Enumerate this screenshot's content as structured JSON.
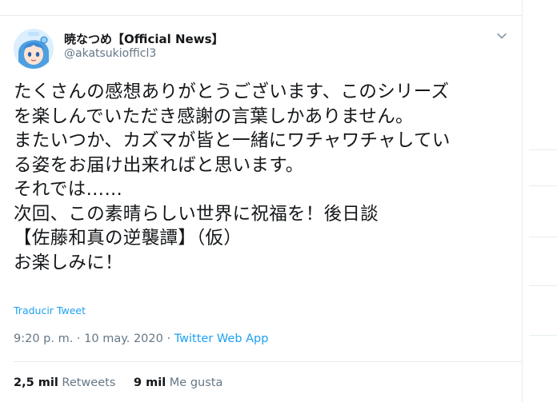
{
  "author": {
    "name": "暁なつめ【Official News】",
    "handle": "@akatsukiofficl3"
  },
  "tweet": {
    "lines": "たくさんの感想ありがとうございます、このシリーズ\nを楽しんでいただき感謝の言葉しかありません。\nまたいつか、カズマが皆と一緒にワチャワチャしてい\nる姿をお届け出来ればと思います。\nそれでは……\n次回、この素晴らしい世界に祝福を！後日談\n【佐藤和真の逆襲譚】（仮）\nお楽しみに！",
    "translate_label": "Traducir Tweet"
  },
  "meta": {
    "time": "9:20 p. m.",
    "separator": " · ",
    "date": "10 may. 2020",
    "app": "Twitter Web App"
  },
  "stats": {
    "retweets_count": "2,5 mil",
    "retweets_label": "Retweets",
    "likes_count": "9 mil",
    "likes_label": "Me gusta"
  },
  "icons": {
    "caret": "chevron-down-icon",
    "avatar": "avatar"
  },
  "colors": {
    "accent": "#1da1f2",
    "secondary_text": "#657786",
    "divider": "#e6ecf0"
  }
}
